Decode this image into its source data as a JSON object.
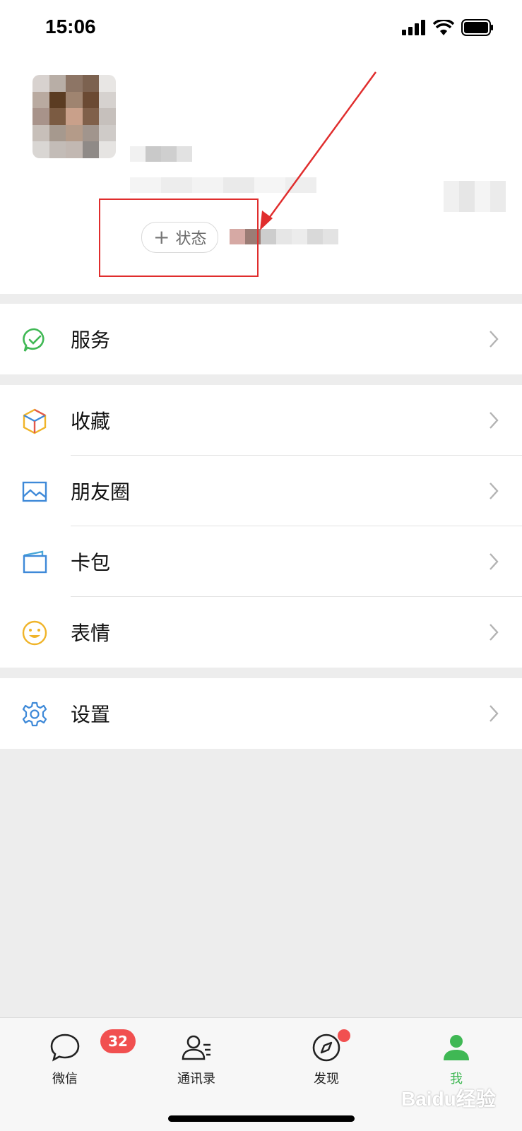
{
  "status_bar": {
    "time": "15:06"
  },
  "profile": {
    "status_button": "状态"
  },
  "menu": {
    "service": "服务",
    "favorites": "收藏",
    "moments": "朋友圈",
    "cards": "卡包",
    "stickers": "表情",
    "settings": "设置"
  },
  "tabbar": {
    "tabs": [
      {
        "label": "微信",
        "icon": "chat-icon",
        "badge": "32"
      },
      {
        "label": "通讯录",
        "icon": "contacts-icon"
      },
      {
        "label": "发现",
        "icon": "discover-compass-icon",
        "dot": true
      },
      {
        "label": "我",
        "icon": "me-person-icon",
        "active": true
      }
    ]
  },
  "colors": {
    "accent_green": "#3fb854",
    "badge_red": "#f15050",
    "annotation_red": "#e02d2d"
  },
  "watermark": "Baidu经验"
}
